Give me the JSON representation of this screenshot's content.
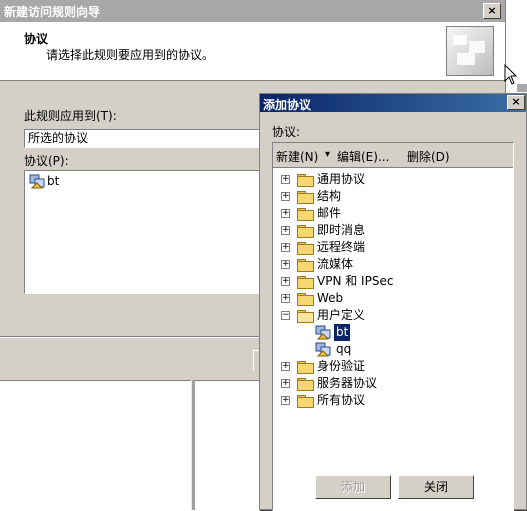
{
  "wizard": {
    "title": "新建访问规则向导",
    "close_label": "×",
    "header_title": "协议",
    "header_subtitle": "请选择此规则要应用到的协议。",
    "apply_label": "此规则应用到(T):",
    "apply_value": "所选的协议",
    "protocols_label": "协议(P):",
    "protocols": [
      {
        "name": "bt"
      }
    ]
  },
  "dialog": {
    "title": "添加协议",
    "close_label": "×",
    "protocols_label": "协议:",
    "toolbar": {
      "new": "新建(N)",
      "arrow": "▾",
      "edit": "编辑(E)...",
      "delete": "删除(D)"
    },
    "tree": [
      {
        "label": "通用协议",
        "expanded": false
      },
      {
        "label": "结构",
        "expanded": false
      },
      {
        "label": "邮件",
        "expanded": false
      },
      {
        "label": "即时消息",
        "expanded": false
      },
      {
        "label": "远程终端",
        "expanded": false
      },
      {
        "label": "流媒体",
        "expanded": false
      },
      {
        "label": "VPN 和 IPSec",
        "expanded": false
      },
      {
        "label": "Web",
        "expanded": false
      },
      {
        "label": "用户定义",
        "expanded": true,
        "children": [
          {
            "label": "bt",
            "selected": true
          },
          {
            "label": "qq",
            "selected": false
          }
        ]
      },
      {
        "label": "身份验证",
        "expanded": false
      },
      {
        "label": "服务器协议",
        "expanded": false
      },
      {
        "label": "所有协议",
        "expanded": false
      }
    ],
    "add_button": "添加",
    "close_button": "关闭"
  }
}
